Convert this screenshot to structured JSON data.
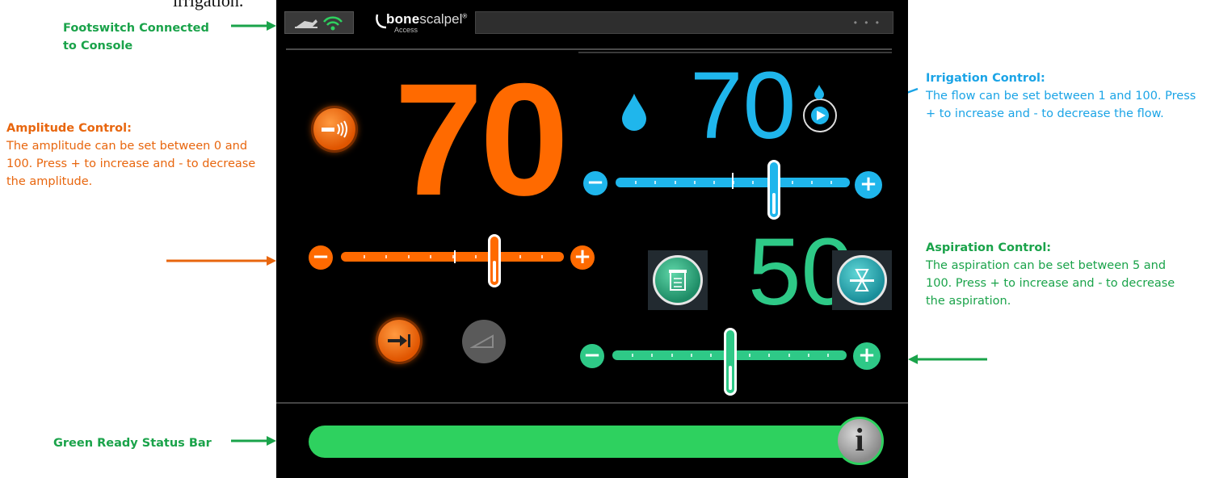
{
  "annotations": {
    "footswitch": "Footswitch Connected to Console",
    "amplitude_title": "Amplitude Control:",
    "amplitude_text": "The amplitude can be set between 0 and 100. Press + to increase and - to decrease the amplitude.",
    "irrigation_title": "Irrigation Control:",
    "irrigation_text": "The flow can be set between 1 and 100. Press + to increase and - to decrease the flow.",
    "aspiration_title": "Aspiration Control:",
    "aspiration_text": "The aspiration can be set between 5 and 100. Press + to increase and - to decrease the aspiration.",
    "status": "Green Ready Status Bar",
    "cut_text": "irrigation."
  },
  "header": {
    "logo_bone": "bone",
    "logo_scalpel": "scalpel",
    "logo_trademark": "®",
    "logo_sub": "Access",
    "menu_dots": "• • •"
  },
  "amplitude": {
    "value": "70",
    "level": 0.7,
    "minus": "−",
    "plus": "+",
    "color": "#ff6a00"
  },
  "irrigation": {
    "value": "70",
    "level": 0.7,
    "minus": "−",
    "plus": "+",
    "color": "#1fb6ec"
  },
  "aspiration": {
    "value": "50",
    "level": 0.5,
    "minus": "−",
    "plus": "+",
    "color": "#2ec987"
  },
  "status_bar": {
    "color": "#2ed15f",
    "info_glyph": "i"
  },
  "icons": {
    "footswitch": "footswitch-icon",
    "wifi": "wifi-icon",
    "amplitude_mode": "ultrasonic-handpiece-icon",
    "irrigation_prime": "prime-play-icon",
    "irrigation_drop": "water-drop-icon",
    "aspiration_canister": "canister-icon",
    "aspiration_tube": "suction-tube-icon",
    "continuous_mode": "continuous-mode-icon",
    "ramp_mode": "ramp-mode-icon",
    "info": "info-icon"
  }
}
